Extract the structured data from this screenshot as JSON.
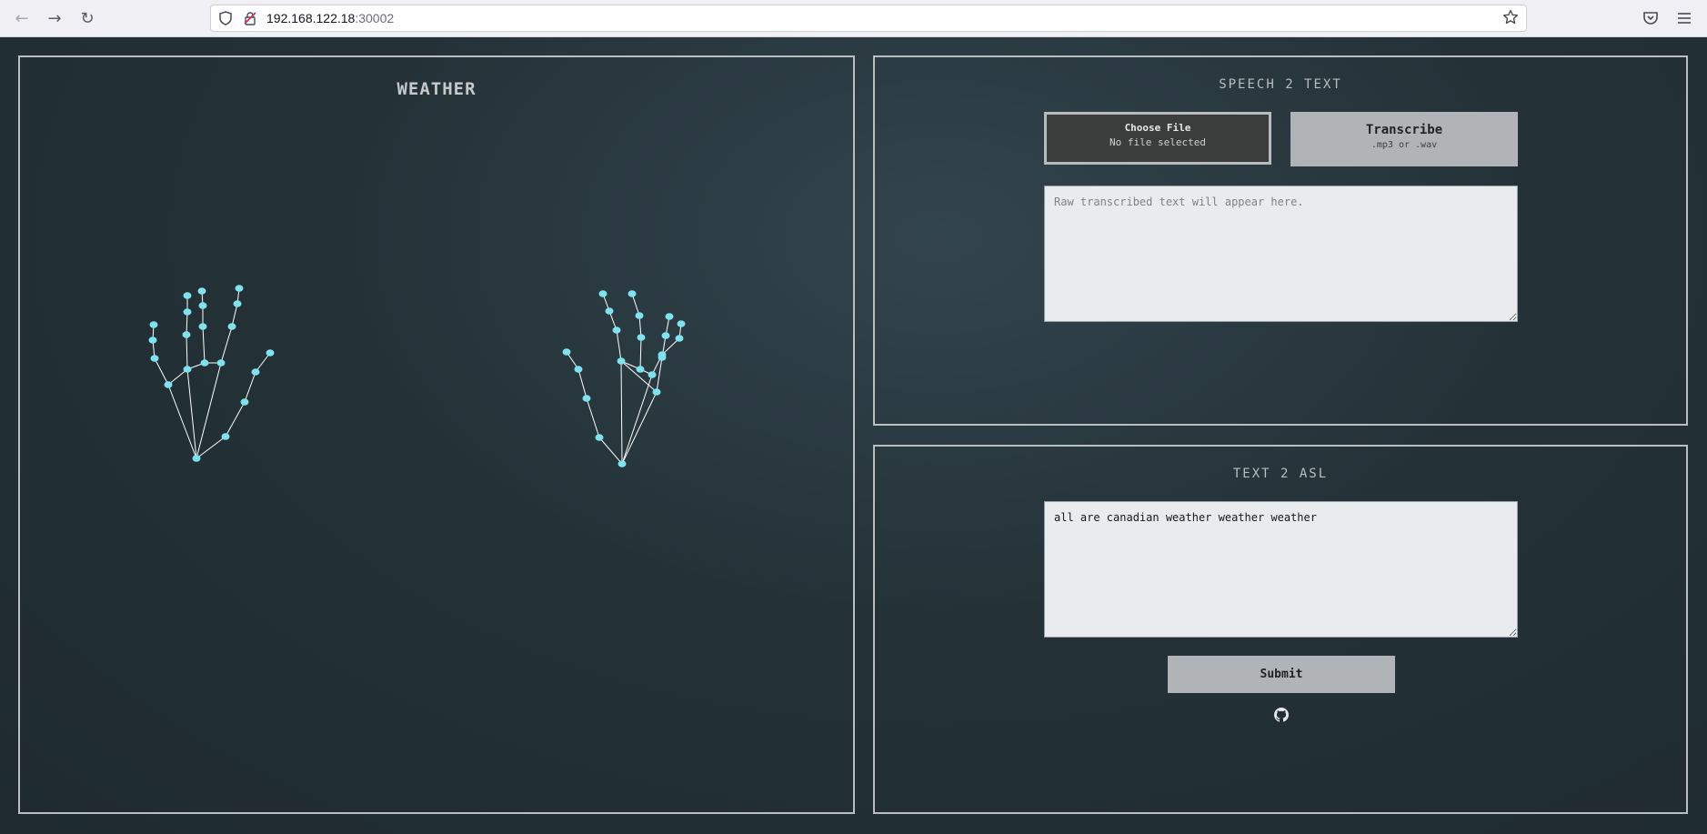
{
  "browser": {
    "url_host": "192.168.122.18",
    "url_port": ":30002",
    "icons": [
      "back-icon",
      "forward-icon",
      "reload-icon",
      "shield-icon",
      "lock-warning-icon",
      "bookmark-star-icon",
      "pocket-icon",
      "menu-icon"
    ]
  },
  "weather_panel": {
    "title": "WEATHER"
  },
  "speech_panel": {
    "title": "SPEECH 2 TEXT",
    "choose_file_label": "Choose File",
    "no_file_text": "No file selected",
    "transcribe_label": "Transcribe",
    "transcribe_hint": ".mp3 or .wav",
    "raw_placeholder": "Raw transcribed text will appear here."
  },
  "asl_panel": {
    "title": "TEXT 2 ASL",
    "input_value": "all are canadian weather weather weather",
    "submit_label": "Submit",
    "github_icon": "github-icon"
  },
  "colors": {
    "page_bg": "#243238",
    "panel_border": "#b9bec1",
    "landmark": "#7fe3ef",
    "bone": "#ffffff"
  }
}
